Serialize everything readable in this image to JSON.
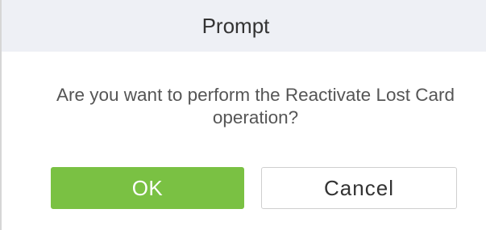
{
  "dialog": {
    "title": "Prompt",
    "message": "Are you want to perform the Reactivate Lost Card operation?",
    "buttons": {
      "ok_label": "OK",
      "cancel_label": "Cancel"
    }
  },
  "colors": {
    "header_background": "#eef0f5",
    "ok_button": "#7ac143",
    "cancel_border": "#cfcfcf",
    "message_text": "#555555"
  }
}
